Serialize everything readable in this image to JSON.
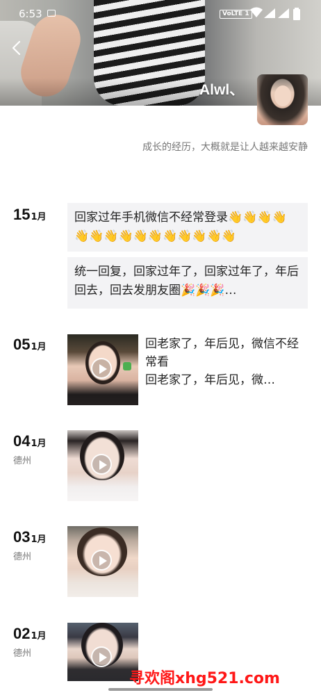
{
  "status_bar": {
    "time": "6:53",
    "network": "VoLTE 1"
  },
  "profile": {
    "nickname": "Alwl、",
    "signature": "成长的经历，大概就是让人越来越安静"
  },
  "moments": [
    {
      "day": "15",
      "month": "1月",
      "location": "",
      "posts": [
        {
          "type": "text",
          "text": "回家过年手机微信不经常登录👋👋👋👋👋👋👋👋👋👋👋👋👋👋👋"
        },
        {
          "type": "text",
          "text": "统一回复，回家过年了，回家过年了，年后回去，回去发朋友圈🎉🎉🎉…"
        }
      ]
    },
    {
      "day": "05",
      "month": "1月",
      "location": "",
      "posts": [
        {
          "type": "video",
          "text_line1": "回老家了，年后见，微信不经常看",
          "text_line2": "回老家了，年后见，微…"
        }
      ]
    },
    {
      "day": "04",
      "month": "1月",
      "location": "德州",
      "posts": [
        {
          "type": "video"
        }
      ]
    },
    {
      "day": "03",
      "month": "1月",
      "location": "德州",
      "posts": [
        {
          "type": "video"
        }
      ]
    },
    {
      "day": "02",
      "month": "1月",
      "location": "德州",
      "posts": [
        {
          "type": "video"
        }
      ]
    }
  ],
  "watermark": "寻欢阁xhg521.com",
  "icons": {
    "back": "chevron-left-icon",
    "play": "play-icon",
    "wifi": "wifi-icon",
    "signal": "signal-icon",
    "battery": "battery-icon",
    "gallery": "image-notification-icon"
  }
}
